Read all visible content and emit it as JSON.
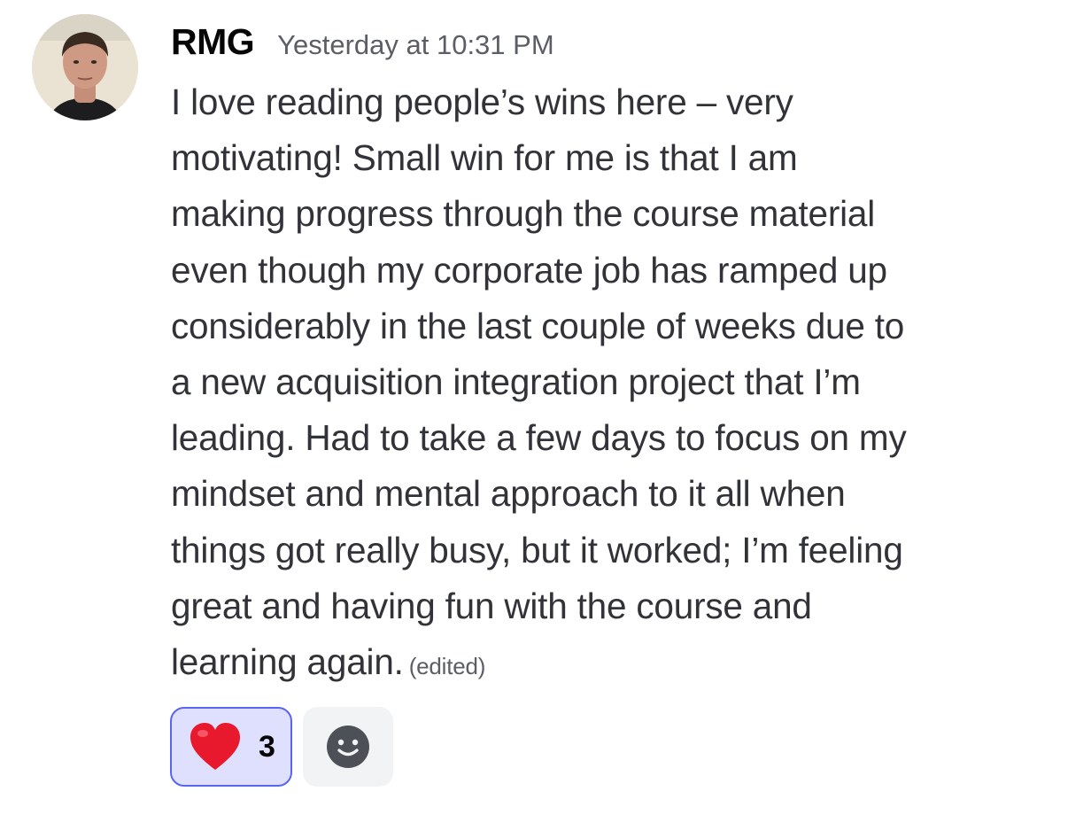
{
  "message": {
    "author": "RMG",
    "timestamp": "Yesterday at 10:31 PM",
    "lines": [
      "I love reading people’s wins here – very",
      "motivating!  Small win for me is that I am",
      "making progress through the course material",
      "even though my corporate job has ramped up",
      "considerably in the last couple of weeks due to",
      "a new acquisition integration project that I’m",
      "leading. Had to take a few days to focus on my",
      "mindset and mental approach to it all when",
      "things got really busy, but it worked; I’m feeling",
      "great and having fun with the course and",
      "learning again."
    ],
    "edited_label": "(edited)"
  },
  "reactions": [
    {
      "emoji": "heart-emoji",
      "count": "3",
      "color": "#e8192c"
    }
  ],
  "add_reaction": {
    "icon": "smile-icon"
  },
  "colors": {
    "reaction_bg": "#dfe0fd",
    "reaction_border": "#5865f2",
    "add_reaction_bg": "#f2f3f5"
  }
}
